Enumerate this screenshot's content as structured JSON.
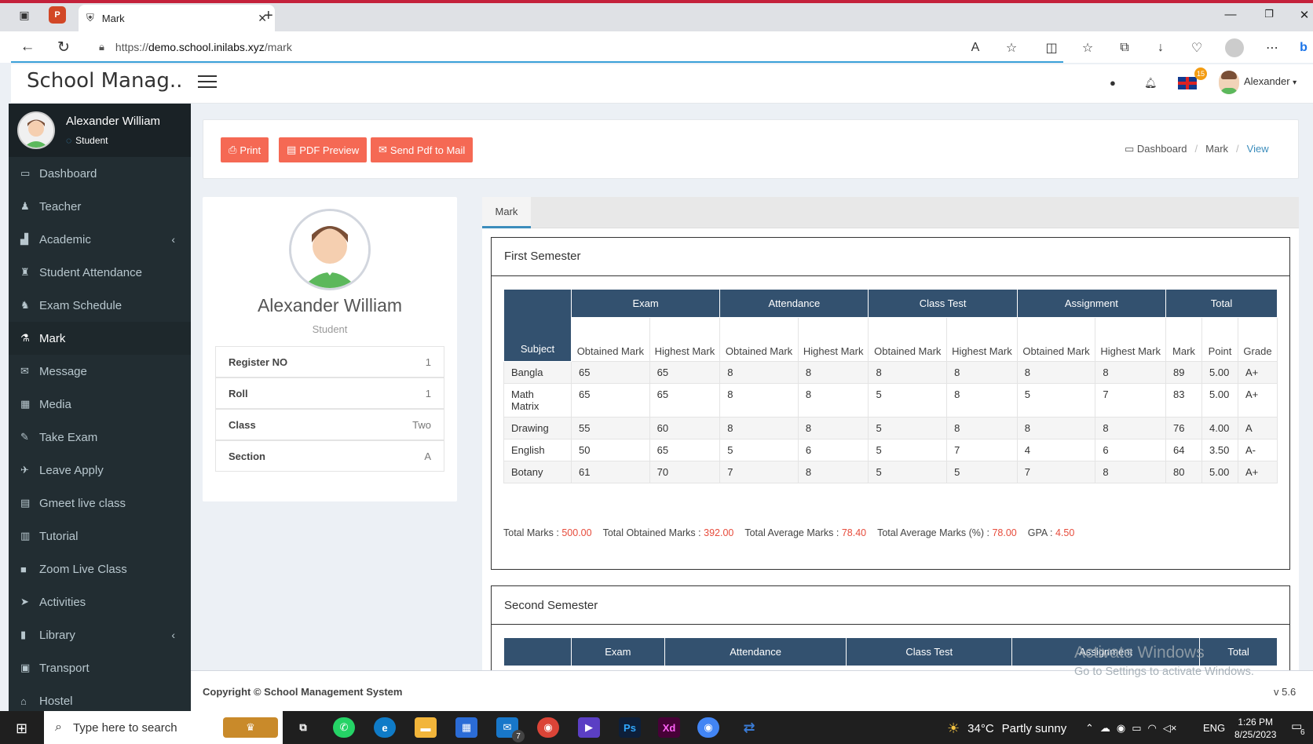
{
  "browser": {
    "tab_title": "Mark",
    "new_tab": "+",
    "url_prefix": "https://",
    "url_domain": "demo.school.inilabs.xyz",
    "url_path": "/mark"
  },
  "header": {
    "brand": "School Manag..",
    "notification_badge": "15",
    "user_name": "Alexander"
  },
  "sidebar": {
    "profile_name": "Alexander William",
    "profile_role": "Student",
    "items": [
      {
        "label": "Dashboard",
        "icon": "laptop-icon"
      },
      {
        "label": "Teacher",
        "icon": "teacher-icon"
      },
      {
        "label": "Academic",
        "icon": "academic-icon"
      },
      {
        "label": "Student Attendance",
        "icon": "attendance-icon"
      },
      {
        "label": "Exam Schedule",
        "icon": "schedule-icon"
      },
      {
        "label": "Mark",
        "icon": "flask-icon"
      },
      {
        "label": "Message",
        "icon": "envelope-icon"
      },
      {
        "label": "Media",
        "icon": "film-icon"
      },
      {
        "label": "Take Exam",
        "icon": "exam-icon"
      },
      {
        "label": "Leave Apply",
        "icon": "plane-icon"
      },
      {
        "label": "Gmeet live class",
        "icon": "file-icon"
      },
      {
        "label": "Tutorial",
        "icon": "book-icon"
      },
      {
        "label": "Zoom Live Class",
        "icon": "video-icon"
      },
      {
        "label": "Activities",
        "icon": "fighter-jet-icon"
      },
      {
        "label": "Library",
        "icon": "library-icon"
      },
      {
        "label": "Transport",
        "icon": "bus-icon"
      },
      {
        "label": "Hostel",
        "icon": "hostel-icon"
      }
    ]
  },
  "actions": {
    "print": "Print",
    "pdf_preview": "PDF Preview",
    "send_pdf": "Send Pdf to Mail"
  },
  "breadcrumb": {
    "dashboard": "Dashboard",
    "mark": "Mark",
    "view": "View"
  },
  "profile_card": {
    "name": "Alexander William",
    "role": "Student",
    "rows": [
      {
        "key": "Register NO",
        "value": "1"
      },
      {
        "key": "Roll",
        "value": "1"
      },
      {
        "key": "Class",
        "value": "Two"
      },
      {
        "key": "Section",
        "value": "A"
      }
    ]
  },
  "mark_tab": "Mark",
  "table_headers": {
    "subject": "Subject",
    "exam": "Exam",
    "attendance": "Attendance",
    "class_test": "Class Test",
    "assignment": "Assignment",
    "total": "Total",
    "obtained": "Obtained Mark",
    "highest": "Highest Mark",
    "mark": "Mark",
    "point": "Point",
    "grade": "Grade"
  },
  "semesters": [
    {
      "title": "First Semester",
      "rows": [
        [
          "Bangla",
          "65",
          "65",
          "8",
          "8",
          "8",
          "8",
          "8",
          "8",
          "89",
          "5.00",
          "A+"
        ],
        [
          "Math Matrix",
          "65",
          "65",
          "8",
          "8",
          "5",
          "8",
          "5",
          "7",
          "83",
          "5.00",
          "A+"
        ],
        [
          "Drawing",
          "55",
          "60",
          "8",
          "8",
          "5",
          "8",
          "8",
          "8",
          "76",
          "4.00",
          "A"
        ],
        [
          "English",
          "50",
          "65",
          "5",
          "6",
          "5",
          "7",
          "4",
          "6",
          "64",
          "3.50",
          "A-"
        ],
        [
          "Botany",
          "61",
          "70",
          "7",
          "8",
          "5",
          "5",
          "7",
          "8",
          "80",
          "5.00",
          "A+"
        ]
      ],
      "totals": {
        "total_marks_label": "Total Marks :",
        "total_marks": "500.00",
        "obtained_label": "Total Obtained Marks :",
        "obtained": "392.00",
        "average_label": "Total Average Marks :",
        "average": "78.40",
        "average_pct_label": "Total Average Marks (%) :",
        "average_pct": "78.00",
        "gpa_label": "GPA :",
        "gpa": "4.50"
      }
    },
    {
      "title": "Second Semester"
    }
  ],
  "footer": {
    "copyright": "Copyright © School Management System",
    "version": "v 5.6"
  },
  "watermark": {
    "line1": "Activate Windows",
    "line2": "Go to Settings to activate Windows."
  },
  "taskbar": {
    "search_placeholder": "Type here to search",
    "temperature": "34°C",
    "weather": "Partly sunny",
    "language": "ENG",
    "time": "1:26 PM",
    "date": "8/25/2023",
    "mail_badge": "7",
    "notif_badge": "6"
  },
  "colors": {
    "sidebar_bg": "#222d32",
    "button_red": "#f56954",
    "table_header": "#33516f",
    "accent": "#3c8dbc"
  }
}
